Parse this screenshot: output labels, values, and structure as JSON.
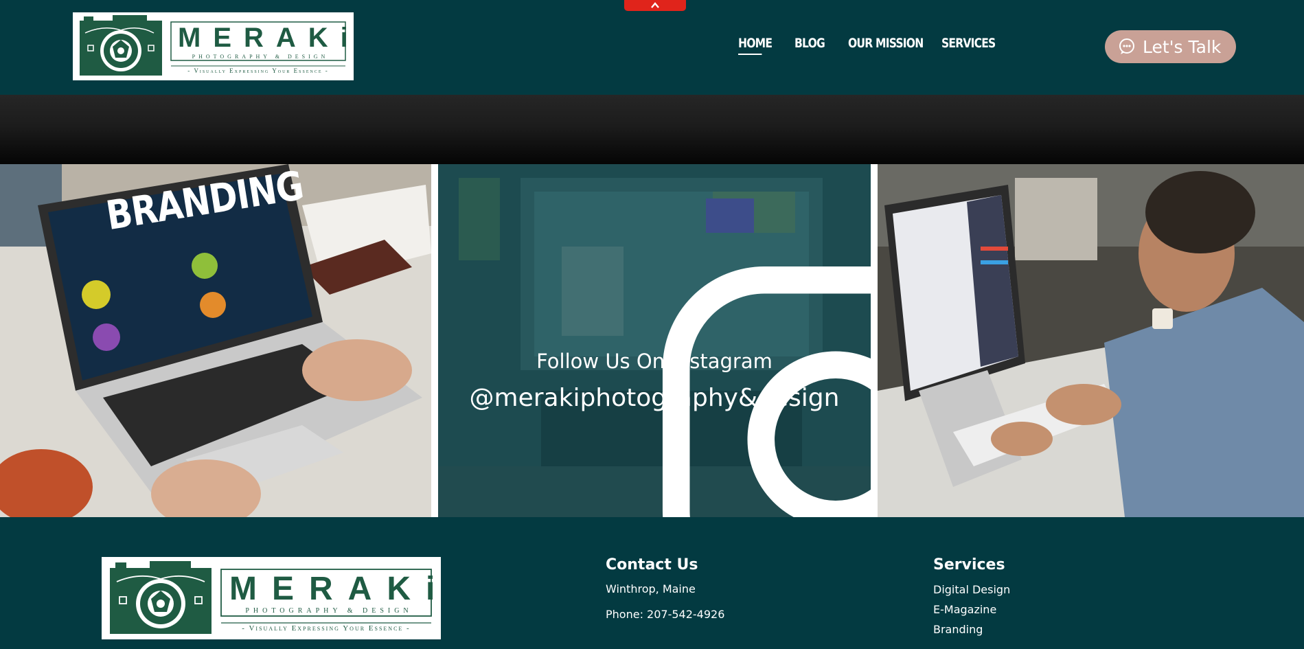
{
  "brand": {
    "name": "MERAKi",
    "tagline_top": "PHOTOGRAPHY & DESIGN",
    "tagline_bottom": "- Visually Expressing Your Essence -"
  },
  "nav": {
    "items": [
      {
        "label": "HOME",
        "active": true
      },
      {
        "label": "BLOG"
      },
      {
        "label": "OUR MISSION"
      },
      {
        "label": "SERVICES"
      }
    ]
  },
  "cta": {
    "label": "Let's Talk",
    "icon": "chat-bubble-icon"
  },
  "gallery": {
    "tile1_text": "BRANDING",
    "instagram": {
      "icon": "instagram-icon",
      "follow": "Follow Us On Instagram",
      "handle": "@merakiphotography&design"
    }
  },
  "footer": {
    "contact": {
      "heading": "Contact Us",
      "location": "Winthrop, Maine",
      "phone": "Phone: 207-542-4926"
    },
    "services": {
      "heading": "Services",
      "items": [
        "Digital Design",
        "E-Magazine",
        "Branding"
      ]
    }
  },
  "colors": {
    "teal": "#033a41",
    "cta": "#c9a196",
    "top_tab": "#e0241b",
    "logo_green": "#1f5b43"
  }
}
